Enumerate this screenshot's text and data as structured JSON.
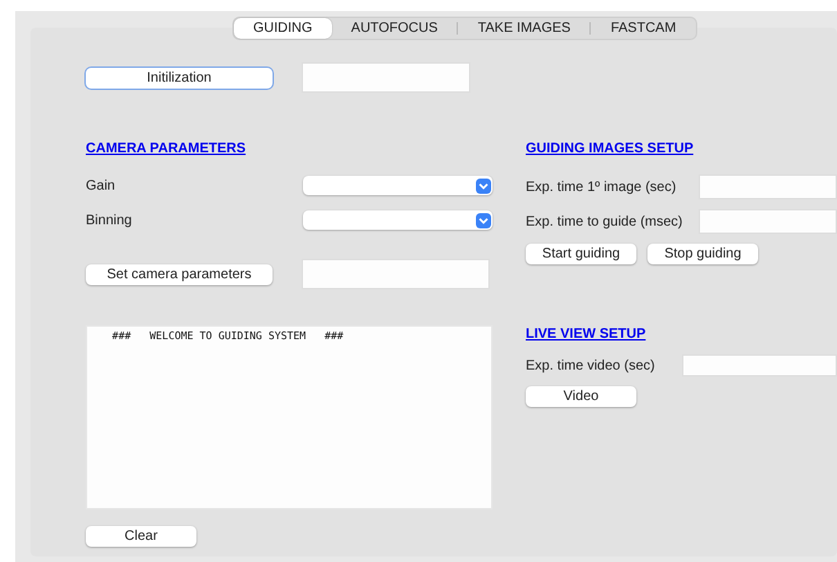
{
  "tabs": [
    {
      "label": "GUIDING",
      "selected": true
    },
    {
      "label": "AUTOFOCUS",
      "selected": false
    },
    {
      "label": "TAKE IMAGES",
      "selected": false
    },
    {
      "label": "FASTCAM",
      "selected": false
    }
  ],
  "init_button": "Initilization",
  "camera_parameters": {
    "title": "CAMERA PARAMETERS",
    "gain_label": "Gain",
    "binning_label": "Binning",
    "set_button": "Set camera parameters"
  },
  "log": {
    "lines": [
      "    ###   WELCOME TO GUIDING SYSTEM   ###"
    ]
  },
  "clear_button": "Clear",
  "guiding_images_setup": {
    "title": "GUIDING IMAGES SETUP",
    "first_exposure_label": "Exp. time 1º image (sec)",
    "guide_exposure_label": "Exp. time to guide (msec)",
    "start_button": "Start guiding",
    "stop_button": "Stop guiding"
  },
  "live_view_setup": {
    "title": "LIVE VIEW SETUP",
    "exposure_label": "Exp. time video (sec)",
    "video_button": "Video"
  }
}
